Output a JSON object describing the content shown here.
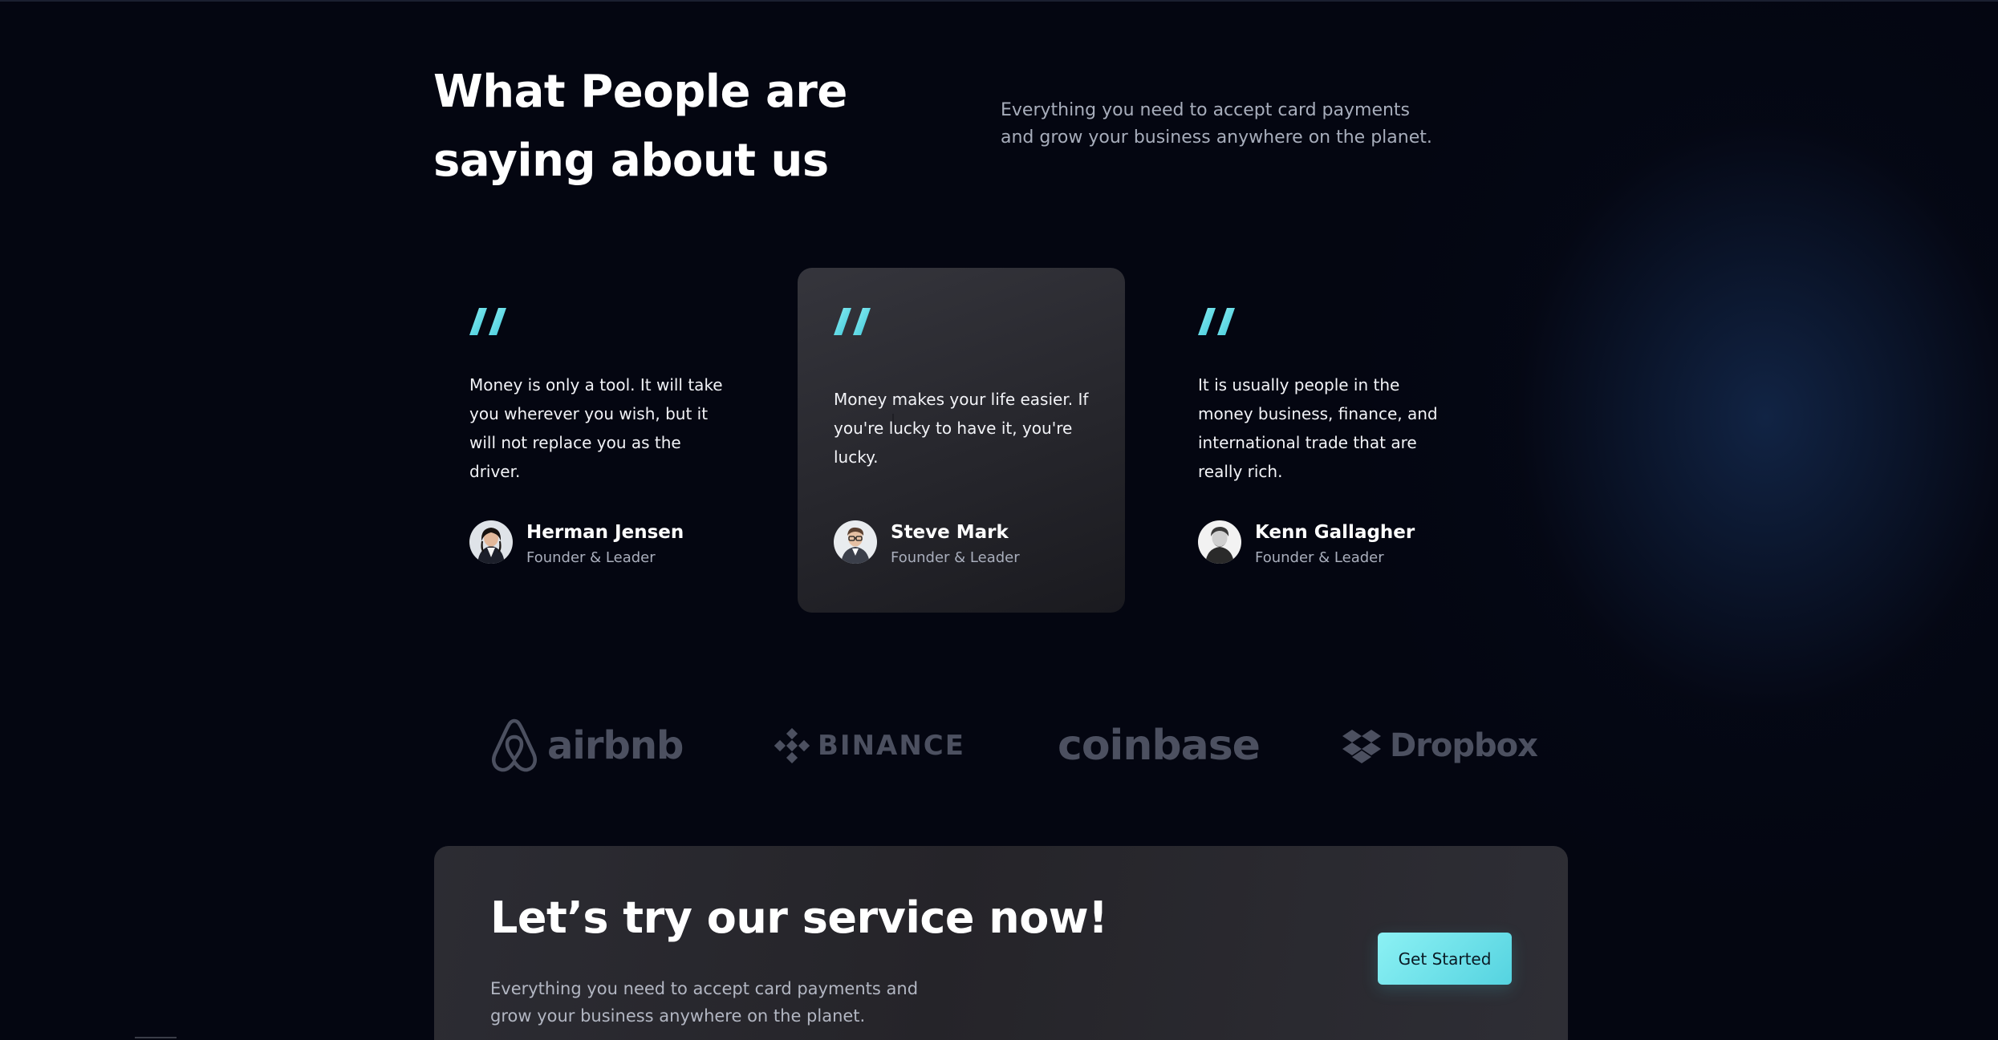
{
  "section": {
    "title": "What People are saying about us",
    "subtitle": "Everything you need to accept card payments and grow your business anywhere on the planet."
  },
  "testimonials": [
    {
      "quote": "Money is only a tool. It will take you wherever you wish, but it will not replace you as the driver.",
      "name": "Herman Jensen",
      "role": "Founder & Leader",
      "highlighted": false
    },
    {
      "quote": "Money makes your life easier. If you're lucky to have it, you're lucky.",
      "name": "Steve Mark",
      "role": "Founder & Leader",
      "highlighted": true
    },
    {
      "quote": "It is usually people in the money business, finance, and international trade that are really rich.",
      "name": "Kenn Gallagher",
      "role": "Founder & Leader",
      "highlighted": false
    }
  ],
  "logos": [
    {
      "name": "airbnb",
      "icon": "airbnb-logo-icon"
    },
    {
      "name": "BINANCE",
      "icon": "binance-logo-icon"
    },
    {
      "name": "coinbase",
      "icon": ""
    },
    {
      "name": "Dropbox",
      "icon": "dropbox-logo-icon"
    }
  ],
  "cta": {
    "title": "Let’s try our service now!",
    "text": "Everything you need to accept card payments and grow your business anywhere on the planet.",
    "button_label": "Get Started"
  },
  "colors": {
    "background": "#040611",
    "accent": "#5ed6e2",
    "card_highlight": "#2b2b31",
    "logo_gray": "#4c5060"
  }
}
